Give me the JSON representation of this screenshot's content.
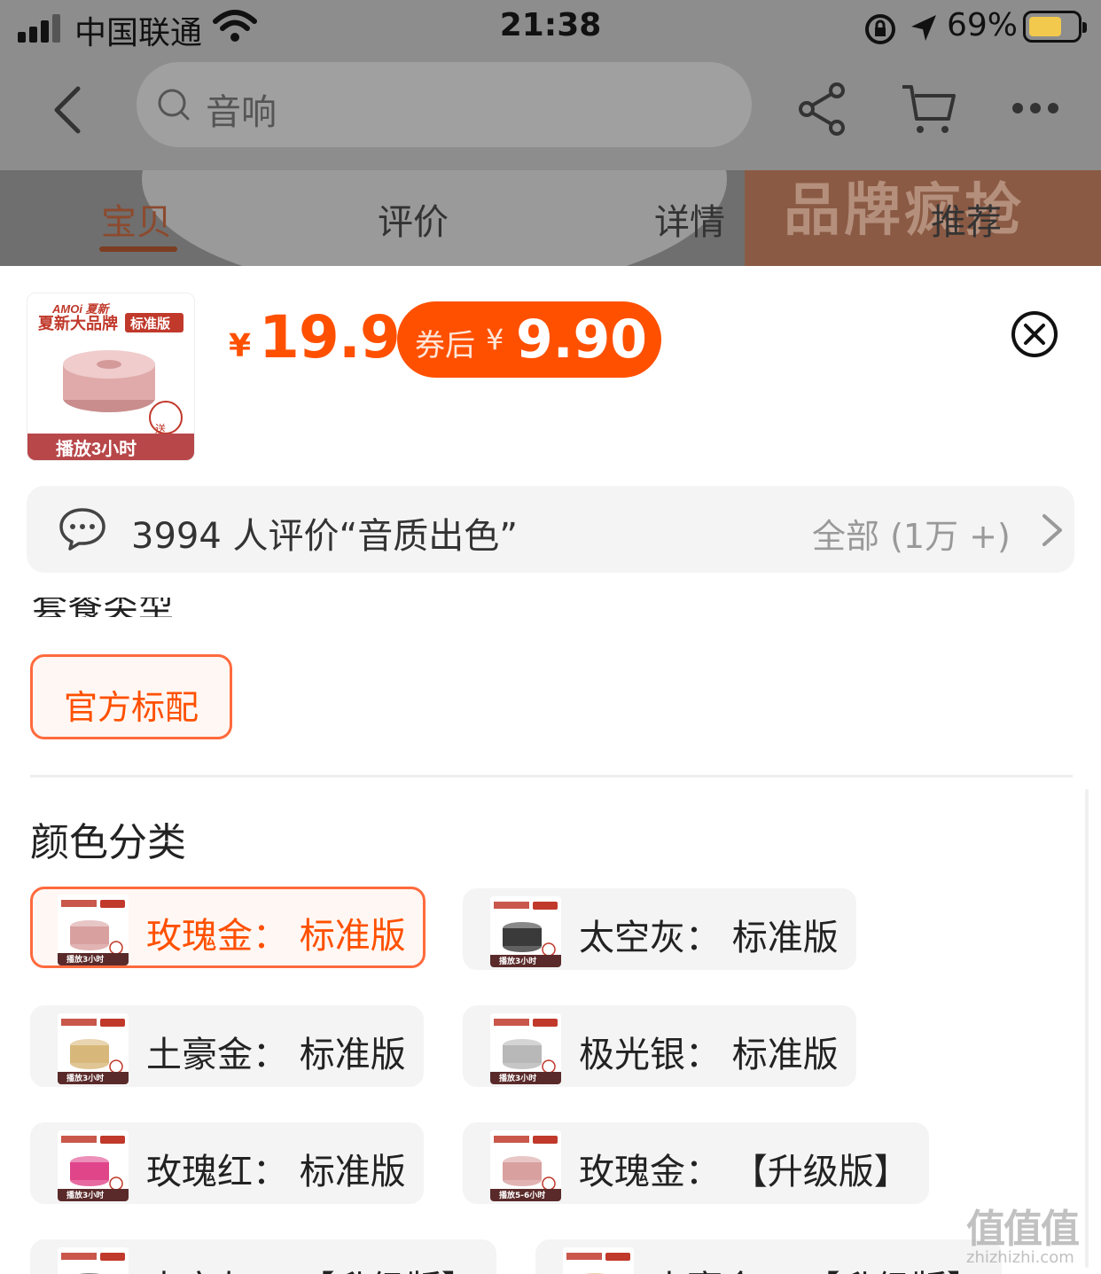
{
  "status_bar": {
    "carrier": "中国联通",
    "time": "21:38",
    "battery_percent": "69%",
    "battery_level": 0.69
  },
  "nav": {
    "search_text": "音响",
    "icons": [
      "back-arrow-icon",
      "search-icon",
      "share-icon",
      "cart-icon",
      "more-icon"
    ]
  },
  "tabs": [
    {
      "label": "宝贝",
      "active": true
    },
    {
      "label": "评价",
      "active": false
    },
    {
      "label": "详情",
      "active": false
    },
    {
      "label": "推荐",
      "active": false
    }
  ],
  "banner_text": "品牌疯抢",
  "product": {
    "thumb_brand": "AMOi 夏新",
    "thumb_slogan": "夏新大品牌",
    "thumb_badge": "标准版",
    "thumb_bottom": "播放3小时",
    "thumb_gift": "送",
    "price_symbol": "¥",
    "price": "19.9",
    "coupon_label": "券后",
    "coupon_symbol": "¥",
    "coupon_price": "9.90"
  },
  "review": {
    "text": "3994 人评价“音质出色”",
    "all": "全部 (1万 +)"
  },
  "package": {
    "title_cut": "套餐类型",
    "option": "官方标配"
  },
  "colors": {
    "title": "颜色分类",
    "options": [
      {
        "label": "玫瑰金：  标准版",
        "selected": true,
        "thumb_color": "#d9a0a0",
        "thumb_bottom": "播放3小时"
      },
      {
        "label": "太空灰：  标准版",
        "selected": false,
        "thumb_color": "#3a3a3a",
        "thumb_bottom": "播放3小时"
      },
      {
        "label": "土豪金：  标准版",
        "selected": false,
        "thumb_color": "#d8b87a",
        "thumb_bottom": "播放3小时"
      },
      {
        "label": "极光银：  标准版",
        "selected": false,
        "thumb_color": "#b8b8b8",
        "thumb_bottom": "播放3小时"
      },
      {
        "label": "玫瑰红：  标准版",
        "selected": false,
        "thumb_color": "#e0458a",
        "thumb_bottom": "播放3小时"
      },
      {
        "label": "玫瑰金：  【升级版】",
        "selected": false,
        "thumb_color": "#d9a0a0",
        "thumb_bottom": "播放5-6小时"
      },
      {
        "label": "太空灰：  【升级版】",
        "selected": false,
        "thumb_color": "#3a3a3a",
        "thumb_bottom": ""
      },
      {
        "label": "土豪金：  【升级版】",
        "selected": false,
        "thumb_color": "#d8b87a",
        "thumb_bottom": ""
      }
    ]
  },
  "watermark": {
    "big": "值值值",
    "small": "zhizhizhi.com"
  },
  "colors_theme": {
    "accent": "#ff5000",
    "selected_border": "#ff6a3d",
    "chip_bg": "#f4f4f4"
  }
}
